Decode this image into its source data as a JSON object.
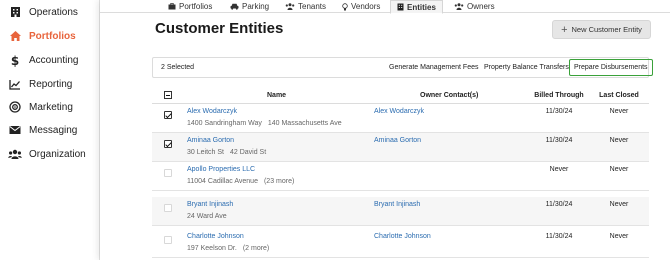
{
  "sidebar": {
    "items": [
      {
        "label": "Operations",
        "icon": "building-icon",
        "active": false
      },
      {
        "label": "Portfolios",
        "icon": "home-icon",
        "active": true
      },
      {
        "label": "Accounting",
        "icon": "dollar-icon",
        "active": false
      },
      {
        "label": "Reporting",
        "icon": "chart-icon",
        "active": false
      },
      {
        "label": "Marketing",
        "icon": "target-icon",
        "active": false
      },
      {
        "label": "Messaging",
        "icon": "envelope-icon",
        "active": false
      },
      {
        "label": "Organization",
        "icon": "people-icon",
        "active": false
      }
    ],
    "active_color": "#e8643c"
  },
  "tabs": [
    {
      "label": "Portfolios",
      "icon": "briefcase-icon"
    },
    {
      "label": "Parking",
      "icon": "car-icon"
    },
    {
      "label": "Tenants",
      "icon": "users-icon"
    },
    {
      "label": "Vendors",
      "icon": "lightbulb-icon"
    },
    {
      "label": "Entities",
      "icon": "building-icon",
      "active": true
    },
    {
      "label": "Owners",
      "icon": "users-icon"
    }
  ],
  "page": {
    "title": "Customer Entities",
    "new_button": "New Customer Entity"
  },
  "actions": {
    "selected_count": "2 Selected",
    "generate_fees": "Generate Management Fees",
    "balance_transfers": "Property Balance Transfers",
    "prepare_disbursements": "Prepare Disbursements",
    "highlight_color": "#3aa13a"
  },
  "table": {
    "headers": {
      "name": "Name",
      "owner": "Owner Contact(s)",
      "billed": "Billed Through",
      "closed": "Last Closed"
    },
    "rows": [
      {
        "checked": true,
        "name": "Alex Wodarczyk",
        "addr1": "1400 Sandringham Way",
        "addr2": "140 Massachusetts Ave",
        "owner": "Alex Wodarczyk",
        "billed": "11/30/24",
        "closed": "Never"
      },
      {
        "checked": true,
        "name": "Aminaa Gorton",
        "addr1": "30 Leitch St",
        "addr2": "42 David St",
        "owner": "Aminaa Gorton",
        "billed": "11/30/24",
        "closed": "Never"
      },
      {
        "checked": false,
        "name": "Apollo Properties LLC",
        "addr1": "11004 Cadillac Avenue",
        "addr2": "(23 more)",
        "owner": "",
        "billed": "Never",
        "closed": "Never"
      },
      {
        "checked": false,
        "name": "Bryant Injinash",
        "addr1": "24 Ward Ave",
        "addr2": "",
        "owner": "Bryant Injinash",
        "billed": "11/30/24",
        "closed": "Never"
      },
      {
        "checked": false,
        "name": "Charlotte Johnson",
        "addr1": "197 Keelson Dr.",
        "addr2": "(2 more)",
        "owner": "Charlotte Johnson",
        "billed": "11/30/24",
        "closed": "Never"
      }
    ]
  }
}
